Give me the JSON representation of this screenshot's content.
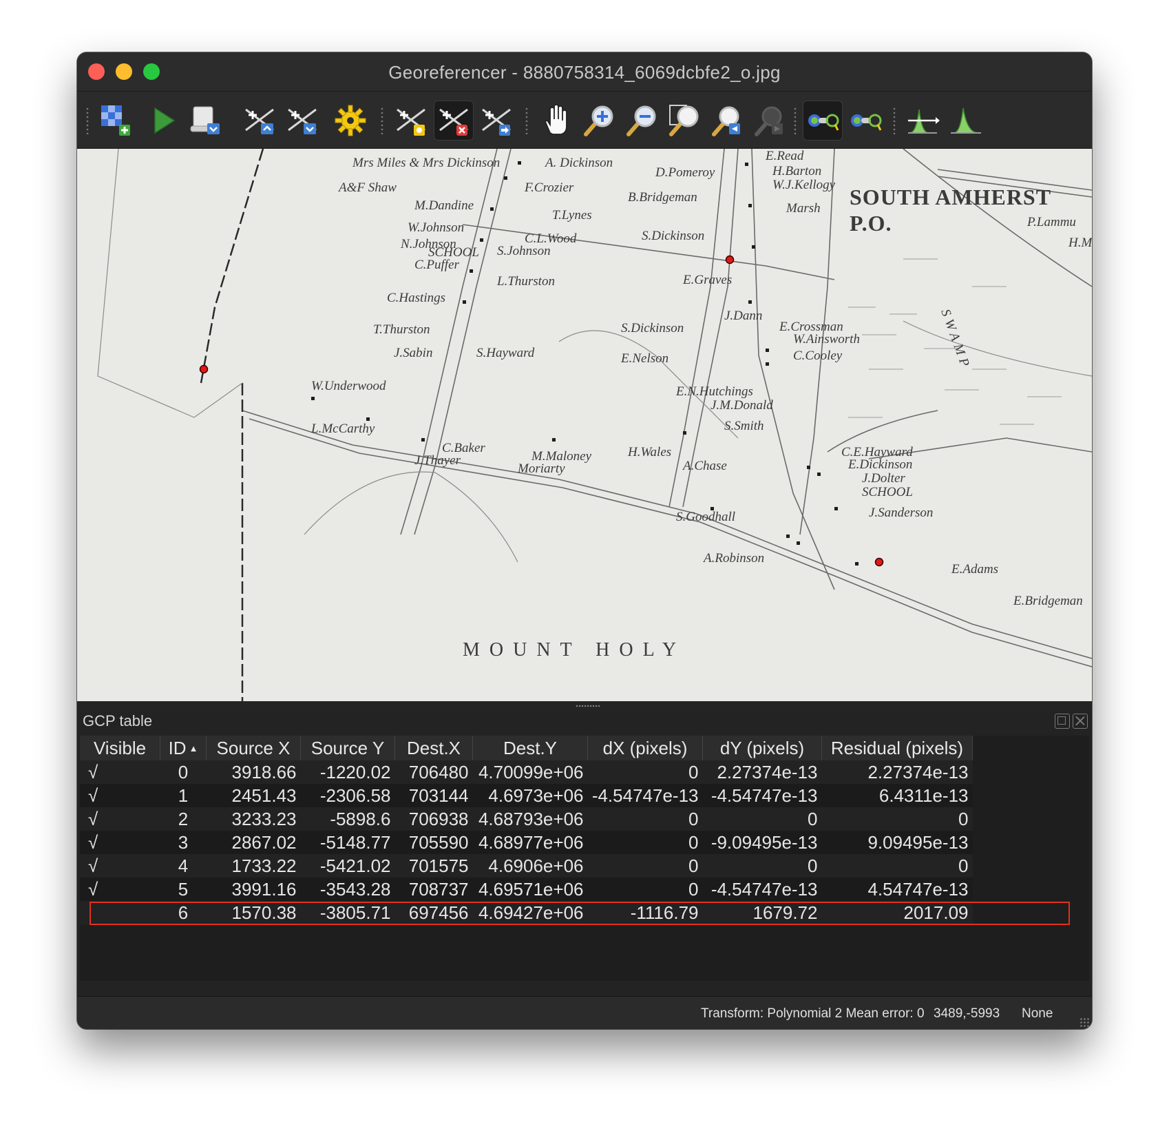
{
  "window": {
    "title": "Georeferencer - 8880758314_6069dcbfe2_o.jpg"
  },
  "toolbar": {
    "buttons": [
      {
        "name": "open-raster",
        "icon": "open-raster-icon"
      },
      {
        "name": "start-georeferencing",
        "icon": "play-icon"
      },
      {
        "name": "generate-gdal-script",
        "icon": "gdal-script-icon"
      },
      {
        "name": "load-gcp-points",
        "icon": "load-gcp-icon"
      },
      {
        "name": "save-gcp-points",
        "icon": "save-gcp-icon"
      },
      {
        "name": "transformation-settings",
        "icon": "gear-icon"
      },
      {
        "name": "add-point",
        "icon": "add-point-icon"
      },
      {
        "name": "delete-point",
        "icon": "delete-point-icon",
        "active": true
      },
      {
        "name": "move-gcp-point",
        "icon": "move-point-icon"
      },
      {
        "name": "pan",
        "icon": "pan-hand-icon"
      },
      {
        "name": "zoom-in",
        "icon": "zoom-in-icon"
      },
      {
        "name": "zoom-out",
        "icon": "zoom-out-icon"
      },
      {
        "name": "zoom-to-layer",
        "icon": "zoom-to-layer-icon"
      },
      {
        "name": "zoom-last",
        "icon": "zoom-last-icon"
      },
      {
        "name": "zoom-next",
        "icon": "zoom-next-icon"
      },
      {
        "name": "link-georeferencer-to-qgis",
        "icon": "link-geo-to-qgis-icon",
        "active": true
      },
      {
        "name": "link-qgis-to-georeferencer",
        "icon": "link-qgis-to-geo-icon"
      },
      {
        "name": "local-histogram-stretch",
        "icon": "histogram-stretch-icon"
      },
      {
        "name": "full-histogram-stretch",
        "icon": "full-histogram-icon"
      }
    ]
  },
  "map": {
    "labels": [
      "Mrs Miles & Mrs Dickinson",
      "A. Dickinson",
      "A&F Shaw",
      "F.Crozier",
      "D.Pomeroy",
      "E.Read",
      "H.Barton",
      "W.J.Kellogy",
      "SOUTH AMHERST",
      "P.O.",
      "P.Lammu",
      "H.M",
      "M.Dandine",
      "B.Bridgeman",
      "Marsh",
      "T.Lynes",
      "W.Johnson",
      "C.L.Wood",
      "N.Johnson",
      "SCHOOL",
      "S.Johnson",
      "S.Dickinson",
      "C.Puffer",
      "L.Thurston",
      "E.Graves",
      "C.Hastings",
      "J.Dann",
      "T.Thurston",
      "S.Dickinson",
      "E.Crossman",
      "W.Ainsworth",
      "C.Cooley",
      "J.Sabin",
      "S.Hayward",
      "E.Nelson",
      "W.Underwood",
      "E.N.Hutchings",
      "J.M.Donald",
      "L.McCarthy",
      "S.Smith",
      "C.Baker",
      "J.Thayer",
      "M.Maloney",
      "Moriarty",
      "H.Wales",
      "A.Chase",
      "C.E.Hayward",
      "E.Dickinson",
      "J.Dolter",
      "SCHOOL",
      "J.Sanderson",
      "A.Robinson",
      "S.Goodhall",
      "E.Adams",
      "E.Bridgeman",
      "SWAMP",
      "MOUNT HOLY"
    ],
    "gcp_marker_color": "#e01818"
  },
  "gcp_panel": {
    "title": "GCP table",
    "columns": [
      "Visible",
      "ID",
      "Source X",
      "Source Y",
      "Dest.X",
      "Dest.Y",
      "dX (pixels)",
      "dY (pixels)",
      "Residual (pixels)"
    ],
    "rows": [
      {
        "visible": "√",
        "id": "0",
        "source_x": "3918.66",
        "source_y": "-1220.02",
        "dest_x": "706480",
        "dest_y": "4.70099e+06",
        "dx": "0",
        "dy": "2.27374e-13",
        "residual": "2.27374e-13"
      },
      {
        "visible": "√",
        "id": "1",
        "source_x": "2451.43",
        "source_y": "-2306.58",
        "dest_x": "703144",
        "dest_y": "4.6973e+06",
        "dx": "-4.54747e-13",
        "dy": "-4.54747e-13",
        "residual": "6.4311e-13"
      },
      {
        "visible": "√",
        "id": "2",
        "source_x": "3233.23",
        "source_y": "-5898.6",
        "dest_x": "706938",
        "dest_y": "4.68793e+06",
        "dx": "0",
        "dy": "0",
        "residual": "0"
      },
      {
        "visible": "√",
        "id": "3",
        "source_x": "2867.02",
        "source_y": "-5148.77",
        "dest_x": "705590",
        "dest_y": "4.68977e+06",
        "dx": "0",
        "dy": "-9.09495e-13",
        "residual": "9.09495e-13"
      },
      {
        "visible": "√",
        "id": "4",
        "source_x": "1733.22",
        "source_y": "-5421.02",
        "dest_x": "701575",
        "dest_y": "4.6906e+06",
        "dx": "0",
        "dy": "0",
        "residual": "0"
      },
      {
        "visible": "√",
        "id": "5",
        "source_x": "3991.16",
        "source_y": "-3543.28",
        "dest_x": "708737",
        "dest_y": "4.69571e+06",
        "dx": "0",
        "dy": "-4.54747e-13",
        "residual": "4.54747e-13"
      },
      {
        "visible": "",
        "id": "6",
        "source_x": "1570.38",
        "source_y": "-3805.71",
        "dest_x": "697456",
        "dest_y": "4.69427e+06",
        "dx": "-1116.79",
        "dy": "1679.72",
        "residual": "2017.09"
      }
    ],
    "highlight_color": "#e2301f"
  },
  "status": {
    "transform": "Transform: Polynomial 2 Mean error: 0",
    "coordinates": "3489,-5993",
    "crs": "None"
  }
}
